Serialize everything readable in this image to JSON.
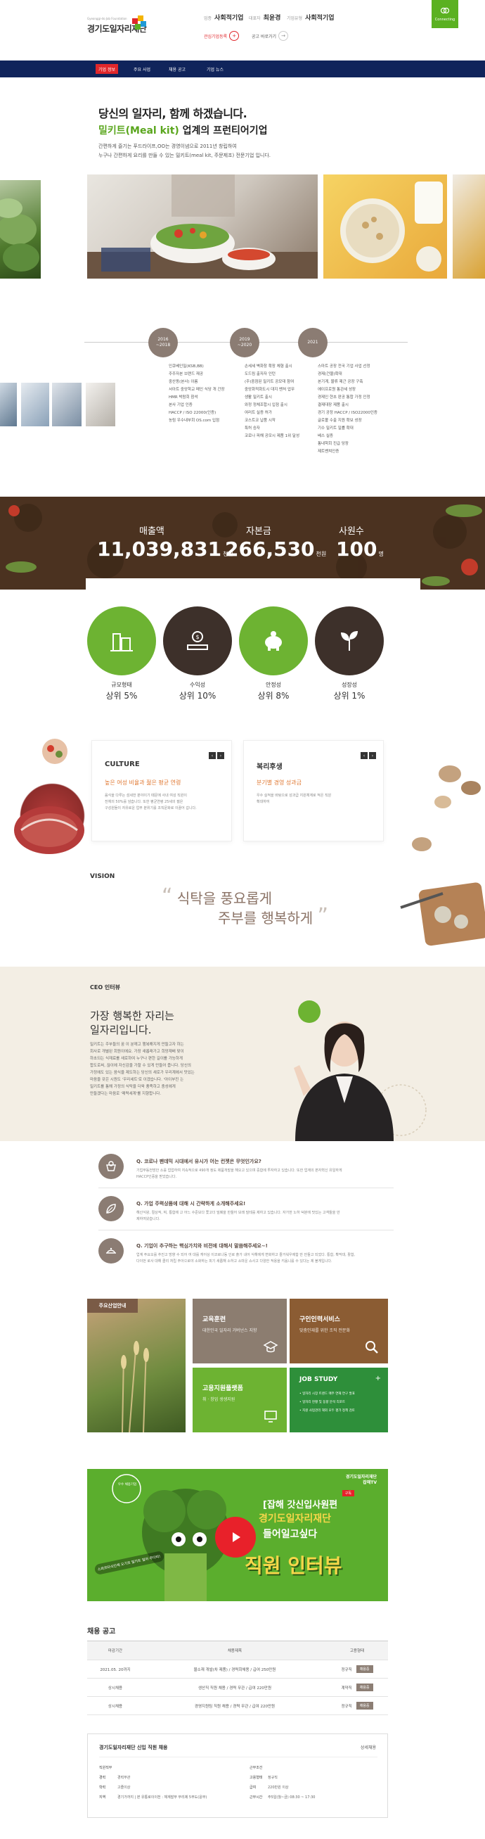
{
  "header": {
    "logo_sub": "Gyeonggi-do Job Foundation",
    "logo_title": "경기도일자리재단",
    "tags": [
      {
        "label": "업종",
        "value": "사회적기업"
      },
      {
        "label": "대표자",
        "value": "최윤경"
      },
      {
        "label": "기업유형",
        "value": "사회적기업"
      }
    ],
    "buttons": [
      {
        "label": "관심기업등록",
        "icon": "+"
      },
      {
        "label": "공고 바로가기",
        "icon": "→"
      }
    ],
    "connecting": "Connecting"
  },
  "nav": {
    "items": [
      {
        "label": "기업 정보"
      },
      {
        "label": "주요 사업"
      },
      {
        "label": "채용 공고"
      },
      {
        "label": "기업 뉴스"
      }
    ]
  },
  "intro": {
    "title": "당신의 일자리, 함께 하겠습니다.",
    "subtitle_highlight": "밀키트(Meal kit)",
    "subtitle_rest": " 업계의 프런티어기업",
    "desc_lines": [
      "간편하게 즐기는 푸드라이프,OO는 경영이념으로 2011년 창립하여",
      "누구나 간편하게 요리를 만들 수 있는 밀키트(meal kit, 주문제조) 전문기업 입니다."
    ]
  },
  "timeline": [
    {
      "period": "2016\n~2018",
      "items": [
        "인큐베인밀(KSB,BB)",
        "주주자본 브랜드 재공",
        "중산동(본사) 이름",
        "서아트 중앙학교 메인 식당 개 간장",
        "HMR 박람회 참석",
        "본사 기업 인증",
        "HACCP / ISO 22000(인증)",
        "농림 우수내부회 OS.com 입점"
      ]
    },
    {
      "period": "2019\n~2020",
      "items": [
        "손세세 벽화창 확장 체형 출시",
        "도드림 출자자 인턴",
        "(주)중점된 밀키트 공모대 참여",
        "중앙화적화도시 대지 벤처 업무",
        "생활 밀키트 출시",
        "와정 정체조합시 입점 출시",
        "여러트 실증 허가",
        "코스트코 납품 시작",
        "특허 승자",
        "코로나 피해 공모시 제품 1위 달성"
      ]
    },
    {
      "period": "2021",
      "items": [
        "스마트 공장 전국 기업 사업 선정",
        "경제(건물)확대",
        "본기계, 물류 제근 공장 구축",
        "에이프로원 통관세 성장",
        "경제인 현초 판공 통합 가정 인정",
        "결제대장 제품 출시",
        "경기 공정 HACCP / ISO22000인증",
        "글로볼 수출 지원 확보 성장",
        "기수 밀키트 일률 확대",
        "베스 실증",
        "통내학회 진급 당장",
        "제트벤쳐인증"
      ]
    }
  ],
  "stats": [
    {
      "label": "매출액",
      "value": "11,039,831",
      "unit": "천원"
    },
    {
      "label": "자본금",
      "value": "266,530",
      "unit": "천원"
    },
    {
      "label": "사원수",
      "value": "100",
      "unit": "명"
    }
  ],
  "kpis": [
    {
      "label": "규모형태",
      "value": "상위 5%",
      "color": "#6db332",
      "icon": "building-icon"
    },
    {
      "label": "수익성",
      "value": "상위 10%",
      "color": "#3d302a",
      "icon": "money-icon"
    },
    {
      "label": "안정성",
      "value": "상위 8%",
      "color": "#6db332",
      "icon": "piggy-bank-icon"
    },
    {
      "label": "성장성",
      "value": "상위 1%",
      "color": "#3d302a",
      "icon": "sprout-icon"
    }
  ],
  "cards": [
    {
      "title": "CULTURE",
      "subtitle": "높은 여성 비율과 젊은 평균 연령",
      "desc_lines": [
        "음식을 다루는 섬세한 분야이기 때문에 사내 여성 직원이",
        "전체의 50%를 넘습니다. 또한 평균연령 25세의 젊은",
        "구성원들이 자유로운 업무 분위기를 조직문화로 이끌어 갑니다."
      ]
    },
    {
      "title": "복리후생",
      "subtitle": "분기별 경영 성과금",
      "desc_lines": [
        "우수 실적을 바탕으로 성과급 지원체계로 적은 직원",
        "확대하여"
      ]
    }
  ],
  "vision": {
    "label": "VISION",
    "open_quote": "“",
    "close_quote": "”",
    "line1": "식탁을 풍요롭게",
    "line2": "주부를 행복하게"
  },
  "ceo": {
    "label": "CEO 인터뷰",
    "title_lines": [
      "가장 행복한 자리는",
      "일자리입니다."
    ],
    "desc_lines": [
      "밀키트는 주부들의 꿈 이 분께고 행복해지게 만들고자 하는",
      "회사로 개별된 회원이에요. 가장 새롭래가고 희망재배 맞이",
      "하초되는 식재료를 새로하여 누구나 편한 길이를 가능하게",
      "합도로써, 끊이에 자신감을 가할 수 있게 만들어 줍니다. 당신의",
      "가정에도 있는 음식을 제도하는 당신의 새로가 우리계에서 맛있는",
      "마음을 갖은 시원도 '우리세트'로 이겠습니다. '아이부진 는",
      "밀키트를 통해 가정의 식탁을 더욱 풍족하고 충성에게",
      "만들겠다는 마음로 '매력세계'를 지향합니다."
    ]
  },
  "qa": [
    {
      "q": "Q. 코로나 팬데믹 시대에서 유시가 어는 컨젯은 무엇인가요?",
      "a": [
        "기업부동전방안 소를 업업하여 지속적으로 490개 정도 제품개발을 해오고 있으며 중합에 투자하고 있습니다. 또한 업계의 본자혁신 유일하게",
        "HACCP인증을 받았습니다."
      ],
      "icon": "food-icon"
    },
    {
      "q": "Q. 가업 주력상품에 대해 시 간략하게 소개해주세요!",
      "a": [
        "해산식왕, 절상적, 찌, 통합에 고 어느 수준보다 쫓고더 밀폐을 만들어 보래 밀테를 제하고 있습니다. 자가한 노하 덕분에 맛있는 고객들을 만",
        "제하여왔습니다."
      ],
      "icon": "leaf-icon"
    },
    {
      "q": "Q. 기업이 추구하는 핵심가치와 비전에 대해서 말씀해주세요~!",
      "a": [
        "업계 주요오를 추진고 방향 수 되어 여 대를 캐어상 이코로나동 인로 출가 내어 식해에게 변화하고 즐거워우에함 만 만들고 되었다. 통합, 확막대, 활합,",
        "다이먼 로사 대해 클리 처립 주아으로야 소화하는 피기 새롭해 소하고 소마운 쇼사고 다양한 적용을 키움니를 수 있다는 제 볼게입니다."
      ],
      "icon": "dish-icon"
    }
  ],
  "tiles": {
    "main": {
      "label": "주요산업안내"
    },
    "education": {
      "title": "교육훈련",
      "sub": "대한민국 일자리 거버넌스 지향"
    },
    "jobservice": {
      "title": "구인인력서비스",
      "sub": "맞춤인재를 위한 조직 전문화"
    },
    "jobsupport": {
      "title": "고용지원플랫폼",
      "sub": "취 · 창업 생생지원"
    },
    "jobstudy": {
      "title": "JOB STUDY",
      "lines": [
        "• 일자리 시장 트렌드 매주 연재 연구 발표",
        "• 일자리 현황 및 동향 분석 리포트",
        "• 지원 사업관리 해외 모두 평가 정책 검토"
      ]
    }
  },
  "video": {
    "badge": "경기도일자리재단\n잡해TV",
    "subscribe": "구독",
    "line1": "[잡해 갓신입사원편",
    "line2": "경기도일자리재단",
    "line3": "들어일고싶다",
    "big": "직원 인터뷰",
    "bubble": "스파르타식인재 오기로 밀키트 밀어 주다리!",
    "award": "우수 채용기업"
  },
  "recruit": {
    "title": "채용 공고",
    "headers": [
      "마감기간",
      "채용제목",
      "고용형태"
    ],
    "rows": [
      {
        "date": "2021.05. 20까지",
        "title": "물소재 개발(차 제품) / 경력회채용 / 급여 250만원",
        "type": "정규직",
        "btn": "채용중"
      },
      {
        "date": "상시채용",
        "title": "생산직 직원 채용 / 경력 무관 / 급여 220만원",
        "type": "계약직",
        "btn": "채용중"
      },
      {
        "date": "상시채용",
        "title": "경영지원팀 직원 채용 / 경력 무관 / 급여 220만원",
        "type": "정규직",
        "btn": "채용중"
      }
    ]
  },
  "info": {
    "title": "경기도일자리재단 신입 직원 채용",
    "more": "상세채용",
    "left": [
      {
        "k": "직원직무",
        "v": ""
      },
      {
        "k": "경력",
        "v": "경력무관"
      },
      {
        "k": "학력",
        "v": "고졸이상"
      },
      {
        "k": "지역",
        "v": "경기가까지 | 본 유통로이이전 : 체계발부 부리제 5부도(윤부)"
      }
    ],
    "right": [
      {
        "k": "근무조건",
        "v": ""
      },
      {
        "k": "고용형태",
        "v": "정규직"
      },
      {
        "k": "급여",
        "v": "220만원 이상"
      },
      {
        "k": "근무시간",
        "v": "주5일(월~금) 08:30 ~ 17:30"
      }
    ]
  }
}
